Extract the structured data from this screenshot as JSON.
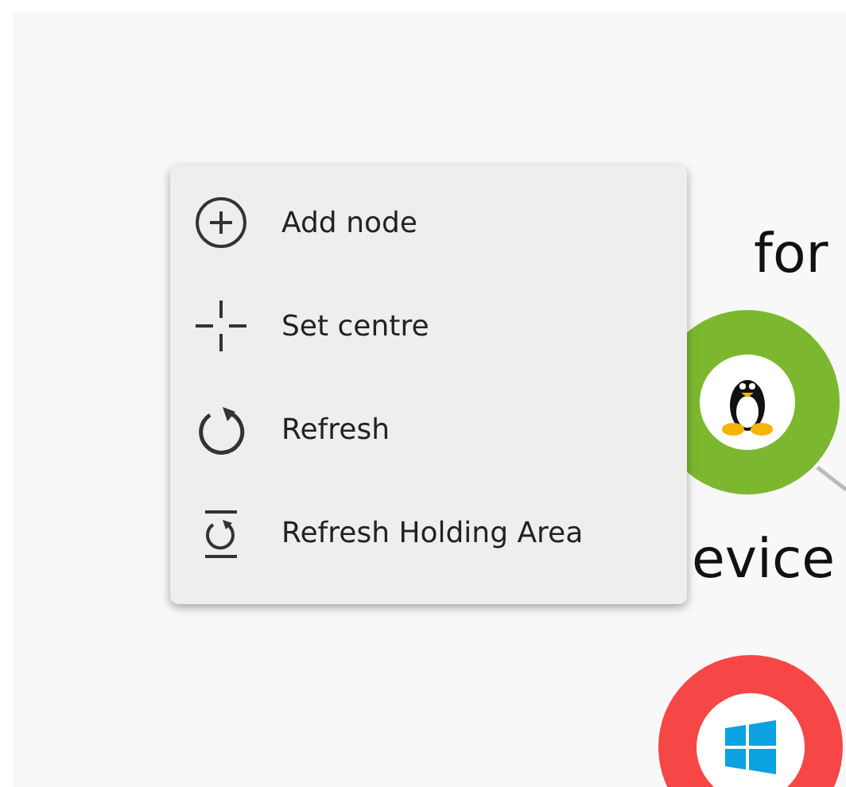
{
  "context_menu": {
    "items": [
      {
        "kind": "add",
        "label": "Add node"
      },
      {
        "kind": "centre",
        "label": "Set centre"
      },
      {
        "kind": "refresh",
        "label": "Refresh"
      },
      {
        "kind": "refresh-holding",
        "label": "Refresh Holding Area"
      }
    ]
  },
  "graph": {
    "labels": [
      "for",
      "evice"
    ],
    "nodes": [
      {
        "kind": "linux",
        "color": "#7cb82f"
      },
      {
        "kind": "windows",
        "color": "#f64646"
      }
    ]
  }
}
